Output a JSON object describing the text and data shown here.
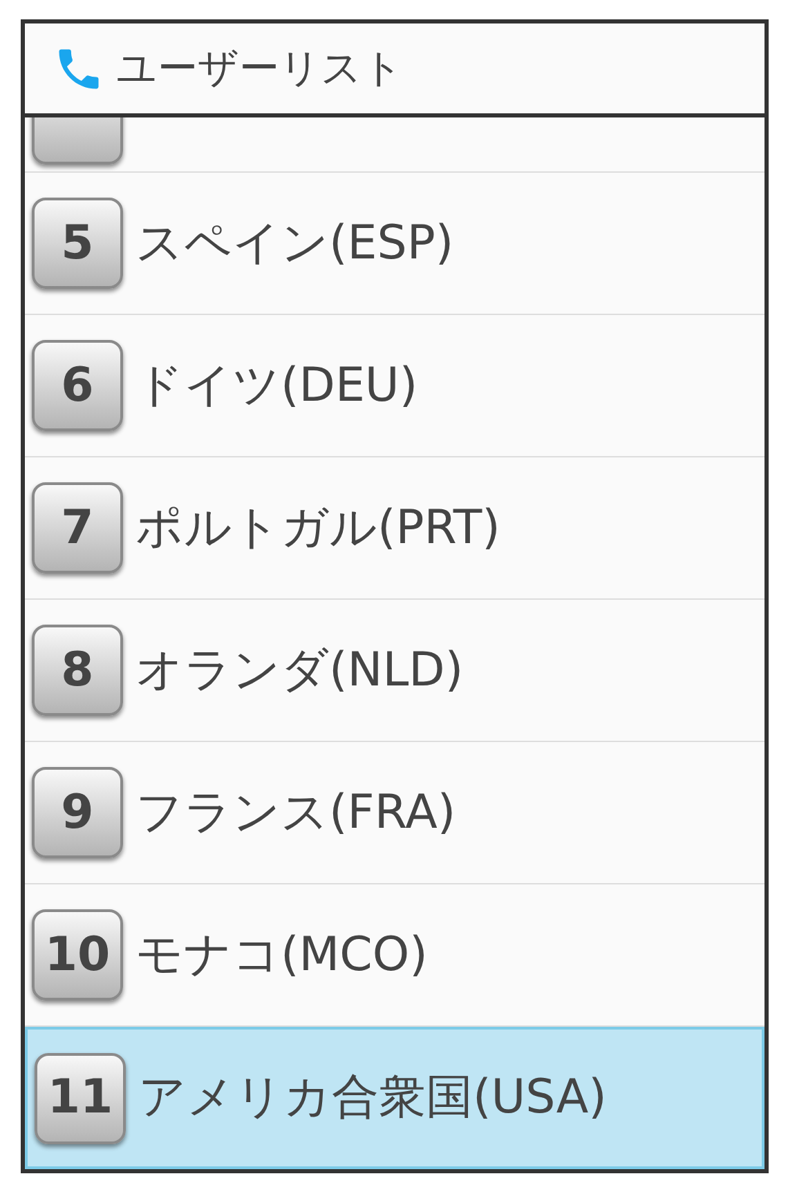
{
  "header": {
    "title": "ユーザーリスト"
  },
  "rows": [
    {
      "number": "5",
      "name": "スペイン(ESP)",
      "selected": false
    },
    {
      "number": "6",
      "name": "ドイツ(DEU)",
      "selected": false
    },
    {
      "number": "7",
      "name": "ポルトガル(PRT)",
      "selected": false
    },
    {
      "number": "8",
      "name": "オランダ(NLD)",
      "selected": false
    },
    {
      "number": "9",
      "name": "フランス(FRA)",
      "selected": false
    },
    {
      "number": "10",
      "name": "モナコ(MCO)",
      "selected": false
    },
    {
      "number": "11",
      "name": "アメリカ合衆国(USA)",
      "selected": true
    }
  ]
}
